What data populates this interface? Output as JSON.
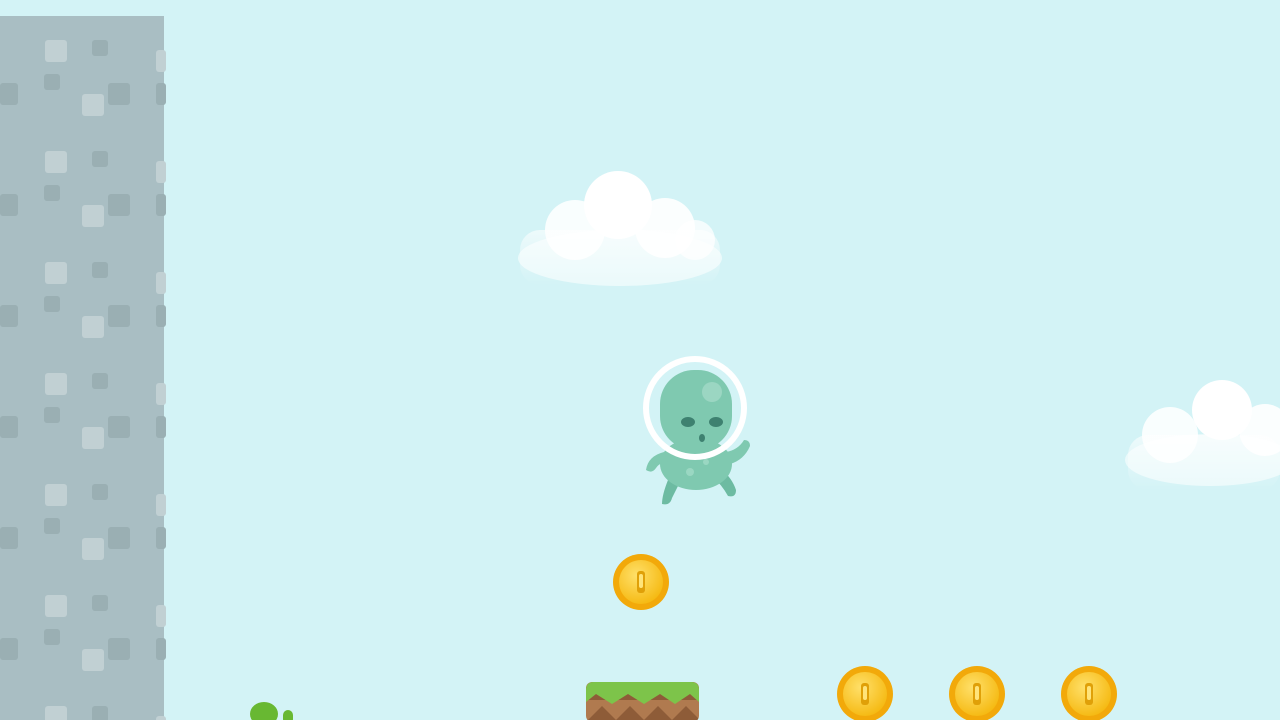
{
  "game": {
    "level": {
      "coins_visible": 4,
      "coins": [
        {
          "row": "upper",
          "count": 1
        },
        {
          "row": "lower",
          "count": 3
        }
      ]
    },
    "colors": {
      "sky": "#d3f3f6",
      "wall": "#a9bec3",
      "wall_block_light": "#c1d0d3",
      "wall_block_dark": "#9aafb3",
      "cloud": "#ffffff",
      "alien": "#7fc9b0",
      "alien_dark": "#4e9a84",
      "helmet": "#ffffff",
      "coin": "#f7c21b",
      "coin_rim": "#f2a90a",
      "grass": "#7dc44a",
      "dirt": "#b07a4f"
    },
    "icons": {
      "player": "alien-astronaut",
      "coin": "gold-coin",
      "cloud": "cloud",
      "platform": "grass-dirt-block",
      "plant": "cactus-sprout"
    }
  }
}
